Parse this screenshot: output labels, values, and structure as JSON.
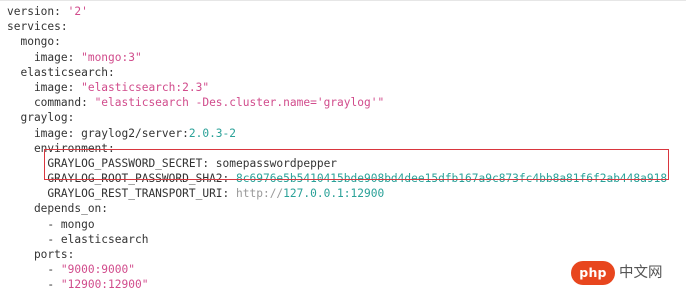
{
  "code": {
    "lines": [
      [
        [
          "k",
          "version: "
        ],
        [
          "s",
          "'2'"
        ]
      ],
      [
        [
          "k",
          "services:"
        ]
      ],
      [
        [
          "k",
          "  mongo:"
        ]
      ],
      [
        [
          "k",
          "    image: "
        ],
        [
          "s",
          "\"mongo:3\""
        ]
      ],
      [
        [
          "k",
          "  elasticsearch:"
        ]
      ],
      [
        [
          "k",
          "    image: "
        ],
        [
          "s",
          "\"elasticsearch:2.3\""
        ]
      ],
      [
        [
          "k",
          "    command: "
        ],
        [
          "s",
          "\"elasticsearch -Des.cluster.name='graylog'\""
        ]
      ],
      [
        [
          "k",
          "  graylog:"
        ]
      ],
      [
        [
          "k",
          "    image: graylog2/server:"
        ],
        [
          "n",
          "2.0.3-2"
        ]
      ],
      [
        [
          "k",
          "    environment:"
        ]
      ],
      [
        [
          "k",
          "      GRAYLOG_PASSWORD_SECRET: somepasswordpepper"
        ]
      ],
      [
        [
          "k",
          "      GRAYLOG_ROOT_PASSWORD_SHA2: "
        ],
        [
          "n",
          "8c6976e5b5410415bde908bd4dee15dfb167a9c873fc4bb8a81f6f2ab448a918"
        ]
      ],
      [
        [
          "k",
          "      GRAYLOG_REST_TRANSPORT_URI: "
        ],
        [
          "u",
          "http://"
        ],
        [
          "n",
          "127.0.0.1:12900"
        ]
      ],
      [
        [
          "k",
          "    depends_on:"
        ]
      ],
      [
        [
          "k",
          "      - mongo"
        ]
      ],
      [
        [
          "k",
          "      - elasticsearch"
        ]
      ],
      [
        [
          "k",
          "    ports:"
        ]
      ],
      [
        [
          "k",
          "      - "
        ],
        [
          "s",
          "\"9000:9000\""
        ]
      ],
      [
        [
          "k",
          "      - "
        ],
        [
          "s",
          "\"12900:12900\""
        ]
      ]
    ]
  },
  "highlight": {
    "color": "#d9363e",
    "covers_lines": [
      10,
      11
    ]
  },
  "watermark": {
    "logo_text": "php",
    "site_text": "中文网",
    "logo_color": "#e8461e"
  },
  "colors": {
    "key": "#333333",
    "string": "#d14c8c",
    "number": "#2aa198",
    "url": "#999999"
  }
}
